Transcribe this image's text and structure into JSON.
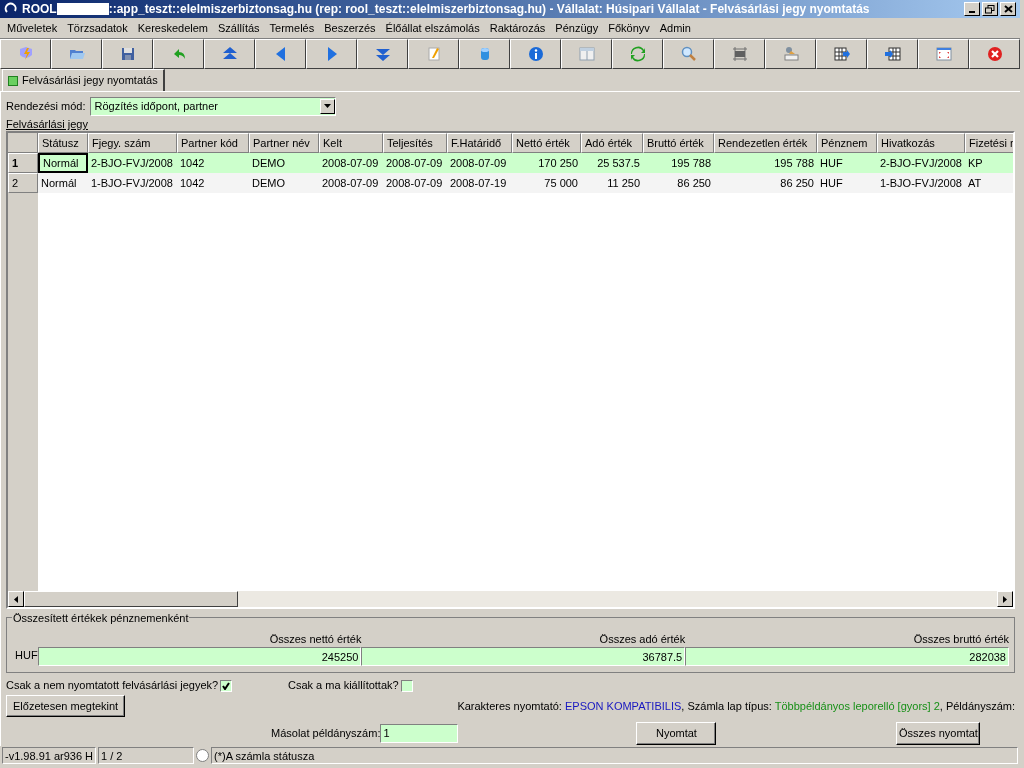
{
  "window": {
    "title_prefix": "ROOL",
    "title": "::app_teszt::elelmiszerbiztonsag.hu (rep: rool_teszt::elelmiszerbiztonsag.hu) - Vállalat: Húsipari Vállalat - Felvásárlási jegy nyomtatás"
  },
  "menu": [
    "Műveletek",
    "Törzsadatok",
    "Kereskedelem",
    "Szállítás",
    "Termelés",
    "Beszerzés",
    "Élőállat elszámolás",
    "Raktározás",
    "Pénzügy",
    "Főkönyv",
    "Admin"
  ],
  "tabs": [
    {
      "label": "Felvásárlási jegy nyomtatás",
      "selected": true
    }
  ],
  "sort": {
    "label": "Rendezési mód:",
    "value": "Rögzítés időpont, partner"
  },
  "grid_label": "Felvásárlási jegy",
  "table": {
    "columns": [
      "Státusz",
      "Fjegy. szám",
      "Partner kód",
      "Partner név",
      "Kelt",
      "Teljesítés",
      "F.Határidő",
      "Nettó érték",
      "Adó érték",
      "Bruttó érték",
      "Rendezetlen érték",
      "Pénznem",
      "Hivatkozás",
      "Fizetési r"
    ],
    "rows": [
      {
        "number": "1",
        "selected": true,
        "cells": [
          "Normál",
          "2-BJO-FVJ/2008",
          "1042",
          "DEMO",
          "2008-07-09",
          "2008-07-09",
          "2008-07-09",
          "170 250",
          "25 537.5",
          "195 788",
          "195 788",
          "HUF",
          "2-BJO-FVJ/2008",
          "KP"
        ]
      },
      {
        "number": "2",
        "selected": false,
        "cells": [
          "Normál",
          "1-BJO-FVJ/2008",
          "1042",
          "DEMO",
          "2008-07-09",
          "2008-07-09",
          "2008-07-19",
          "75 000",
          "11 250",
          "86 250",
          "86 250",
          "HUF",
          "1-BJO-FVJ/2008",
          "AT"
        ]
      }
    ]
  },
  "totals": {
    "title": "Összesített értékek pénznemenként",
    "currency": "HUF",
    "fields": [
      {
        "label": "Összes nettó érték",
        "value": "245250"
      },
      {
        "label": "Összes adó érték",
        "value": "36787.5"
      },
      {
        "label": "Összes bruttó érték",
        "value": "282038"
      }
    ]
  },
  "filters": [
    {
      "label": "Csak a nem nyomtatott felvásárlási jegyek?",
      "checked": true
    },
    {
      "label": "Csak a ma kiállítottak?",
      "checked": false
    }
  ],
  "preview_button": "Előzetesen megtekint",
  "printer_info": [
    {
      "kind": "label",
      "text": "Karakteres nyomtató: "
    },
    {
      "kind": "printer",
      "text": "EPSON KOMPATIBILIS"
    },
    {
      "kind": "label",
      "text": ", Számla lap típus: "
    },
    {
      "kind": "paper",
      "text": "Többpéldányos leporelló [gyors] 2"
    },
    {
      "kind": "label",
      "text": ", Példányszám:"
    }
  ],
  "copies": {
    "label": "Másolat példányszám:",
    "value": "1"
  },
  "print_button": "Nyomtat",
  "print_all_button": "Összes nyomtat",
  "status_bar": {
    "version": "-v1.98.91 ar936 H",
    "position": "1 / 2",
    "note": "(*)A számla státusza"
  }
}
